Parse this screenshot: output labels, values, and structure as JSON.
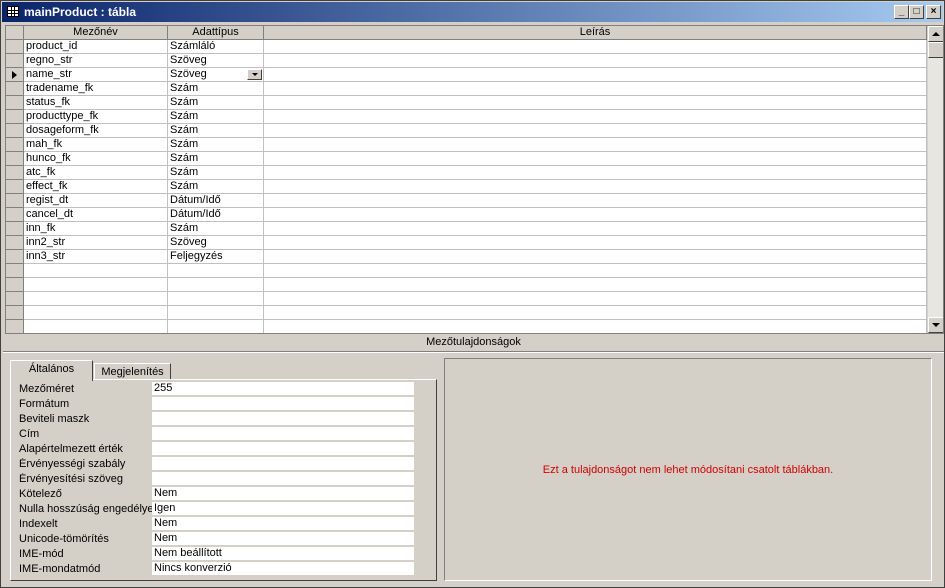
{
  "window": {
    "title": "mainProduct : tábla"
  },
  "grid": {
    "headers": {
      "field_name": "Mezőnév",
      "data_type": "Adattípus",
      "description": "Leírás"
    },
    "rows": [
      {
        "name": "product_id",
        "type": "Számláló"
      },
      {
        "name": "regno_str",
        "type": "Szöveg"
      },
      {
        "name": "name_str",
        "type": "Szöveg",
        "current": true
      },
      {
        "name": "tradename_fk",
        "type": "Szám"
      },
      {
        "name": "status_fk",
        "type": "Szám"
      },
      {
        "name": "producttype_fk",
        "type": "Szám"
      },
      {
        "name": "dosageform_fk",
        "type": "Szám"
      },
      {
        "name": "mah_fk",
        "type": "Szám"
      },
      {
        "name": "hunco_fk",
        "type": "Szám"
      },
      {
        "name": "atc_fk",
        "type": "Szám"
      },
      {
        "name": "effect_fk",
        "type": "Szám"
      },
      {
        "name": "regist_dt",
        "type": "Dátum/Idő"
      },
      {
        "name": "cancel_dt",
        "type": "Dátum/Idő"
      },
      {
        "name": "inn_fk",
        "type": "Szám"
      },
      {
        "name": "inn2_str",
        "type": "Szöveg"
      },
      {
        "name": "inn3_str",
        "type": "Feljegyzés"
      },
      {
        "name": "",
        "type": ""
      },
      {
        "name": "",
        "type": ""
      },
      {
        "name": "",
        "type": ""
      },
      {
        "name": "",
        "type": ""
      },
      {
        "name": "",
        "type": ""
      }
    ]
  },
  "properties_section": {
    "title": "Mezőtulajdonságok",
    "tabs": [
      {
        "label": "Általános",
        "active": true
      },
      {
        "label": "Megjelenítés",
        "active": false
      }
    ],
    "props": [
      {
        "label": "Mezőméret",
        "value": "255"
      },
      {
        "label": "Formátum",
        "value": ""
      },
      {
        "label": "Beviteli maszk",
        "value": ""
      },
      {
        "label": "Cím",
        "value": ""
      },
      {
        "label": "Alapértelmezett érték",
        "value": ""
      },
      {
        "label": "Érvényességi szabály",
        "value": ""
      },
      {
        "label": "Érvényesítési szöveg",
        "value": ""
      },
      {
        "label": "Kötelező",
        "value": "Nem"
      },
      {
        "label": "Nulla hosszúság engedélye",
        "value": "Igen"
      },
      {
        "label": "Indexelt",
        "value": "Nem"
      },
      {
        "label": "Unicode-tömörítés",
        "value": "Nem"
      },
      {
        "label": "IME-mód",
        "value": "Nem beállított"
      },
      {
        "label": "IME-mondatmód",
        "value": "Nincs konverzió"
      }
    ],
    "help_text": "Ezt a tulajdonságot nem lehet módosítani csatolt táblákban."
  },
  "colors": {
    "title_start": "#0a246a",
    "title_end": "#a6caf0",
    "help_text": "#d40000",
    "face": "#d4d0c8"
  }
}
